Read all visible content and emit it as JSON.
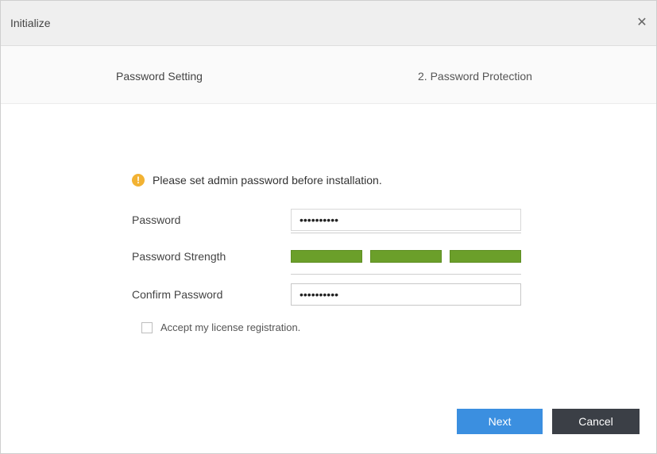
{
  "window": {
    "title": "Initialize"
  },
  "steps": [
    {
      "label": "Password Setting"
    },
    {
      "label": "2. Password Protection"
    }
  ],
  "notice": {
    "text": "Please set admin password before installation."
  },
  "form": {
    "password_label": "Password",
    "password_value": "••••••••••",
    "strength_label": "Password Strength",
    "confirm_label": "Confirm Password",
    "confirm_value": "••••••••••",
    "checkbox_label": "Accept my license registration."
  },
  "buttons": {
    "primary": "Next",
    "cancel": "Cancel"
  },
  "colors": {
    "accent": "#3b8fe0",
    "strength": "#6b9f2a",
    "warning": "#f2b233"
  }
}
